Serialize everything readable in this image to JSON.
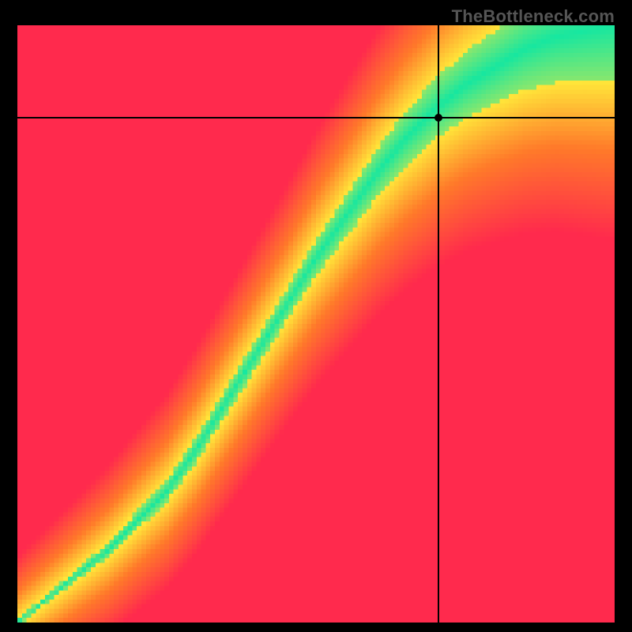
{
  "attribution": "TheBottleneck.com",
  "chart_data": {
    "type": "heatmap",
    "title": "",
    "xlabel": "",
    "ylabel": "",
    "x_range": [
      0,
      1
    ],
    "y_range": [
      0,
      1
    ],
    "ridge": {
      "description": "Optimal diagonal band (green) through gradient field; values are fractional coordinates where the green ridge center lies",
      "points_xy": [
        [
          0.0,
          0.0
        ],
        [
          0.05,
          0.04
        ],
        [
          0.1,
          0.08
        ],
        [
          0.15,
          0.12
        ],
        [
          0.2,
          0.17
        ],
        [
          0.25,
          0.22
        ],
        [
          0.3,
          0.29
        ],
        [
          0.35,
          0.37
        ],
        [
          0.4,
          0.45
        ],
        [
          0.45,
          0.53
        ],
        [
          0.5,
          0.61
        ],
        [
          0.55,
          0.68
        ],
        [
          0.6,
          0.75
        ],
        [
          0.65,
          0.81
        ],
        [
          0.7,
          0.86
        ],
        [
          0.75,
          0.9
        ],
        [
          0.8,
          0.93
        ],
        [
          0.85,
          0.96
        ],
        [
          0.9,
          0.98
        ],
        [
          0.95,
          0.99
        ],
        [
          1.0,
          1.0
        ]
      ],
      "half_widths": [
        0.005,
        0.007,
        0.009,
        0.012,
        0.015,
        0.018,
        0.021,
        0.022,
        0.024,
        0.025,
        0.03,
        0.035,
        0.04,
        0.045,
        0.05,
        0.055,
        0.06,
        0.068,
        0.076,
        0.085,
        0.095
      ]
    },
    "crosshair": {
      "x": 0.705,
      "y": 0.845
    },
    "marker": {
      "x": 0.705,
      "y": 0.845
    },
    "color_scale": {
      "red": "#ff2a4d",
      "orange": "#ff7a2a",
      "yellow": "#ffe63a",
      "green": "#17e8a0"
    }
  }
}
